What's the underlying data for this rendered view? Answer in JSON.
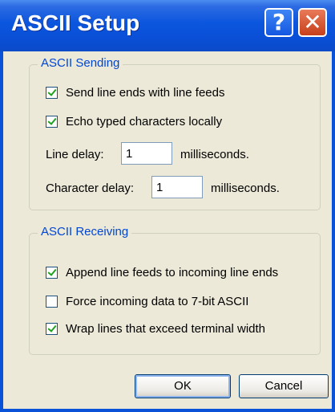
{
  "window": {
    "title": "ASCII Setup",
    "help_icon": "?",
    "close_icon": "✕"
  },
  "sending": {
    "legend": "ASCII Sending",
    "send_line_ends": {
      "label": "Send line ends with line feeds",
      "checked": true
    },
    "echo_typed": {
      "label": "Echo typed characters locally",
      "checked": true
    },
    "line_delay": {
      "label": "Line delay:",
      "value": "1",
      "unit": "milliseconds."
    },
    "char_delay": {
      "label": "Character delay:",
      "value": "1",
      "unit": "milliseconds."
    }
  },
  "receiving": {
    "legend": "ASCII Receiving",
    "append_line_feeds": {
      "label": "Append line feeds to incoming line ends",
      "checked": true
    },
    "force_7bit": {
      "label": "Force incoming data to 7-bit ASCII",
      "checked": false
    },
    "wrap_lines": {
      "label": "Wrap lines that exceed terminal width",
      "checked": true
    }
  },
  "buttons": {
    "ok": "OK",
    "cancel": "Cancel"
  }
}
